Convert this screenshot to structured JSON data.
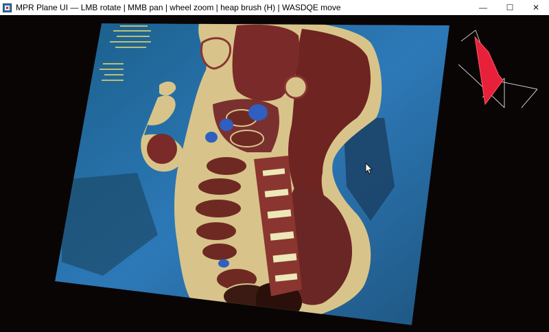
{
  "window": {
    "title": "MPR Plane UI — LMB rotate | MMB pan | wheel zoom | heap brush (H) | WASDQE move",
    "controls": {
      "minimize": "—",
      "maximize": "☐",
      "close": "✕"
    }
  },
  "icons": [
    "app-icon",
    "minimize-icon",
    "maximize-icon",
    "close-icon",
    "mouse-cursor-icon"
  ],
  "colors": {
    "background": "#0a0505",
    "slice_tissue": "#7a2a28",
    "fat": "#d8c48a",
    "gas": "#2f5fc0",
    "water_blue": "#2d79b8",
    "orientation_plane": "#e8203a",
    "orientation_frame": "#cccccc"
  }
}
